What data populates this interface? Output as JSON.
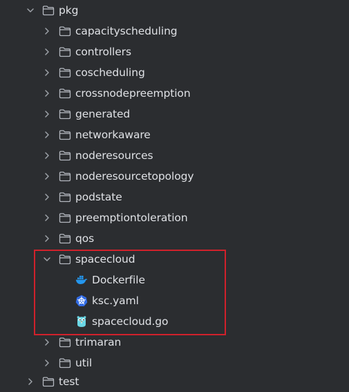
{
  "tree": {
    "root": {
      "label": "pkg",
      "expanded": true,
      "icon": "folder-icon"
    },
    "children": [
      {
        "label": "capacityscheduling",
        "type": "folder",
        "expanded": false
      },
      {
        "label": "controllers",
        "type": "folder",
        "expanded": false
      },
      {
        "label": "coscheduling",
        "type": "folder",
        "expanded": false
      },
      {
        "label": "crossnodepreemption",
        "type": "folder",
        "expanded": false
      },
      {
        "label": "generated",
        "type": "folder",
        "expanded": false
      },
      {
        "label": "networkaware",
        "type": "folder",
        "expanded": false
      },
      {
        "label": "noderesources",
        "type": "folder",
        "expanded": false
      },
      {
        "label": "noderesourcetopology",
        "type": "folder",
        "expanded": false
      },
      {
        "label": "podstate",
        "type": "folder",
        "expanded": false
      },
      {
        "label": "preemptiontoleration",
        "type": "folder",
        "expanded": false
      },
      {
        "label": "qos",
        "type": "folder",
        "expanded": false
      },
      {
        "label": "spacecloud",
        "type": "folder",
        "expanded": true,
        "highlighted": true,
        "files": [
          {
            "label": "Dockerfile",
            "icon": "docker-icon"
          },
          {
            "label": "ksc.yaml",
            "icon": "kubernetes-icon"
          },
          {
            "label": "spacecloud.go",
            "icon": "gopher-icon"
          }
        ]
      },
      {
        "label": "trimaran",
        "type": "folder",
        "expanded": false
      },
      {
        "label": "util",
        "type": "folder",
        "expanded": false
      }
    ],
    "sibling": {
      "label": "test",
      "type": "folder",
      "expanded": false
    }
  },
  "colors": {
    "background": "#2b2d30",
    "text": "#dfe1e5",
    "chevron": "#9ea2a8",
    "folder_outline": "#b4b8bf",
    "highlight_border": "#d1212b",
    "docker_blue": "#2496ed",
    "kubernetes_blue": "#326ce5",
    "gopher": "#6ad7e5"
  }
}
